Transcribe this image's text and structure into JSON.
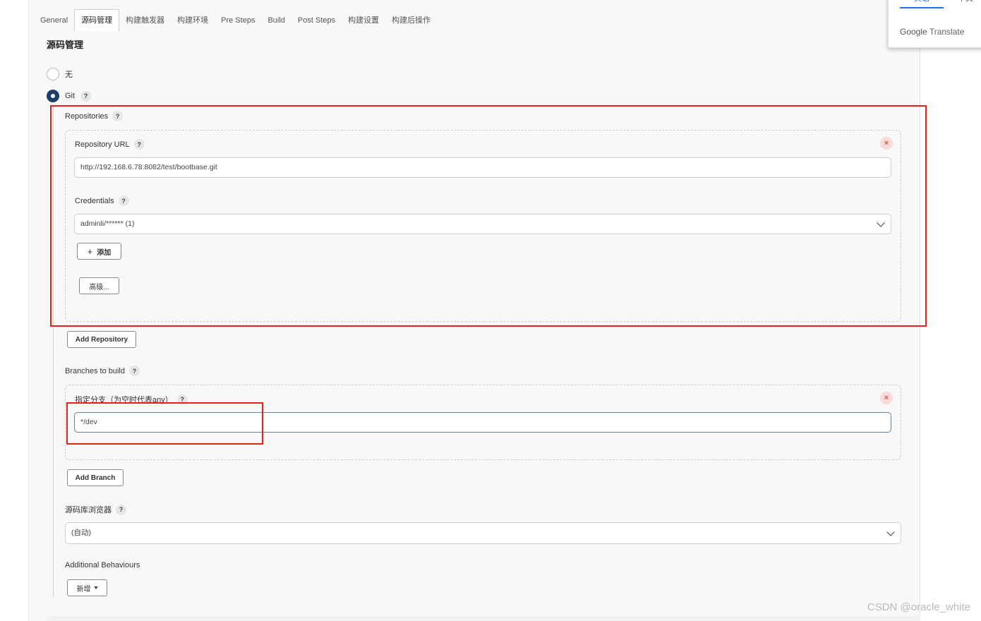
{
  "tabs": [
    {
      "label": "General",
      "active": false
    },
    {
      "label": "源码管理",
      "active": true
    },
    {
      "label": "构建触发器",
      "active": false
    },
    {
      "label": "构建环境",
      "active": false
    },
    {
      "label": "Pre Steps",
      "active": false
    },
    {
      "label": "Build",
      "active": false
    },
    {
      "label": "Post Steps",
      "active": false
    },
    {
      "label": "构建设置",
      "active": false
    },
    {
      "label": "构建后操作",
      "active": false
    }
  ],
  "section_title": "源码管理",
  "scm_options": [
    {
      "label": "无",
      "selected": false
    },
    {
      "label": "Git",
      "selected": true
    }
  ],
  "repositories": {
    "label": "Repositories",
    "repository_url_label": "Repository URL",
    "repository_url_value": "http://192.168.6.78:8082/test/bootbase.git",
    "credentials_label": "Credentials",
    "credentials_value": "adminli/****** (1)",
    "add_button": "添加",
    "advanced_button": "高级...",
    "add_repository_button": "Add Repository"
  },
  "branches": {
    "label": "Branches to build",
    "branch_specifier_label": "指定分支（为空时代表any）",
    "branch_value": "*/dev",
    "add_branch_button": "Add Branch"
  },
  "repo_browser": {
    "label": "源码库浏览器",
    "value": "(自动)"
  },
  "additional_behaviours": {
    "label": "Additional Behaviours",
    "add_button": "新增"
  },
  "translate_popup": {
    "tab1": "英语",
    "tab2": "中文",
    "brand": "Google",
    "product": "Translate"
  },
  "watermark": "CSDN @oracle_white",
  "help_glyph": "?",
  "close_glyph": "×",
  "plus_glyph": "+",
  "colors": {
    "accent": "#1b3f66",
    "annotation": "#e2231a",
    "close_bg": "#fbdada",
    "close_fg": "#d9534f"
  }
}
